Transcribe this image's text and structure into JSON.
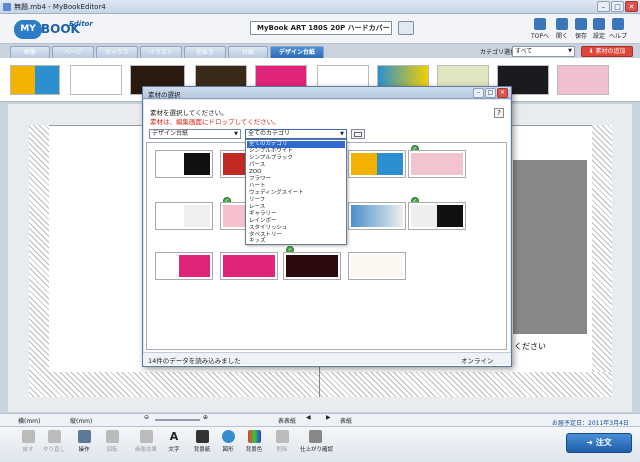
{
  "window": {
    "title": "無題.mb4 - MyBookEditor4",
    "min": "–",
    "max": "□",
    "close": "✕"
  },
  "app": {
    "logo_my": "MY",
    "logo_book": "BOOK",
    "logo_editor": "Editor",
    "product": "MyBook ART 180S 20P ハードカバー"
  },
  "header_buttons": [
    {
      "label": "TOPへ",
      "icon": "home-icon"
    },
    {
      "label": "開く",
      "icon": "folder-icon"
    },
    {
      "label": "保存",
      "icon": "save-icon"
    },
    {
      "label": "設定",
      "icon": "gear-icon"
    },
    {
      "label": "ヘルプ",
      "icon": "help-icon"
    }
  ],
  "tabs": [
    "画像",
    "ページ",
    "ボックス",
    "イラスト",
    "型抜き",
    "台紙",
    "デザイン台紙"
  ],
  "active_tab": "デザイン台紙",
  "category": {
    "label": "カテゴリ選択",
    "value": "すべて"
  },
  "add_material": "素材の追加",
  "dialog": {
    "title": "素材の選択",
    "instruction": "素材を選択してください。",
    "instruction_red": "素材は、編集画面にドロップしてください。",
    "help": "?",
    "select_type": "デザイン台紙",
    "select_category": "全てのカテゴリ",
    "categories": [
      "全てのカテゴリ",
      "シンプルホワイト",
      "シンプルブラック",
      "パース",
      "ZOO",
      "フラワー",
      "ハート",
      "ウェディングスイート",
      "リーフ",
      "レース",
      "ギャラリー",
      "レインボー",
      "スタイリッシュ",
      "タペストリー",
      "キッズ"
    ],
    "status_left": "14件のデータを読み込みました",
    "status_right": "オンライン"
  },
  "canvas_text": "ください",
  "status": {
    "width_label": "横(mm)",
    "height_label": "縦(mm)",
    "prev_spread": "表表紙",
    "next_spread": "表紙",
    "delivery": "お届予定日：2011年3月4日"
  },
  "tools": [
    {
      "label": "戻す",
      "disabled": true
    },
    {
      "label": "やり直し",
      "disabled": true
    },
    {
      "label": "操作",
      "disabled": false
    },
    {
      "label": "回転",
      "disabled": true
    },
    {
      "label": "画像効果",
      "disabled": true
    },
    {
      "label": "文字",
      "disabled": false
    },
    {
      "label": "背景紙",
      "disabled": false
    },
    {
      "label": "図形",
      "disabled": false
    },
    {
      "label": "背景色",
      "disabled": false
    },
    {
      "label": "削除",
      "disabled": true
    },
    {
      "label": "仕上がり確認",
      "disabled": false
    }
  ],
  "order_button": "注文",
  "colors": {
    "accent": "#2d6cb6",
    "add_button": "#e0463a",
    "check": "#4aa54a"
  }
}
